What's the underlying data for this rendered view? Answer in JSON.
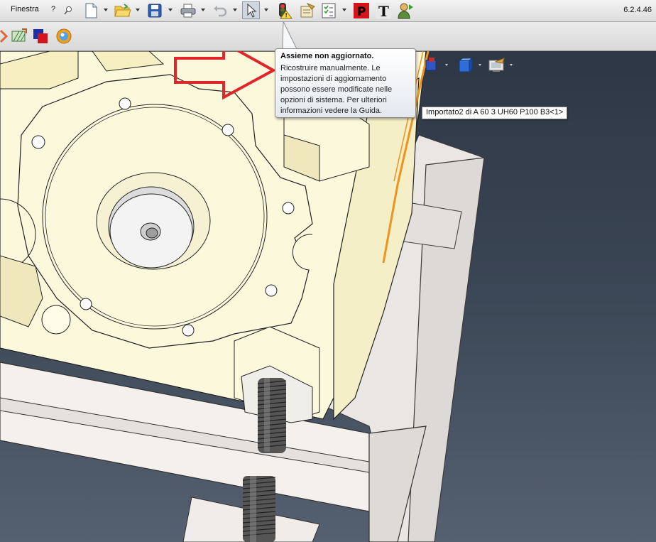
{
  "menu": {
    "window_label": "Finestra",
    "help_label": "?"
  },
  "version": "6.2.4.46",
  "icons": {
    "pin": "pin-icon",
    "new": "new-document-icon",
    "open": "open-folder-icon",
    "save": "save-disk-icon",
    "print": "printer-icon",
    "undo": "undo-icon",
    "select": "select-arrow-icon",
    "traffic_light": "rebuild-traffic-light-icon",
    "file_props": "file-properties-icon",
    "options": "options-checklist-icon",
    "p": "p-red-icon",
    "t": "text-t-icon",
    "user": "user-icon"
  },
  "tooltip": {
    "title": "Assieme non aggiornato.",
    "body": "Ricostruire manualmente. Le impostazioni di aggiornamento possono essere modificate nelle opzioni di sistema. Per ulteriori informazioni vedere la Guida."
  },
  "feature_tooltip": "Importato2 di A 60 3 UH60 P100 B3<1>",
  "colors": {
    "toolbar_bg": "#e6e6e6",
    "viewport_bg": "#35404e",
    "part_face": "#fbf8dc",
    "base_plate": "#f1eeec",
    "highlight_edge": "#f0921c",
    "arrow": "#e0262b"
  }
}
